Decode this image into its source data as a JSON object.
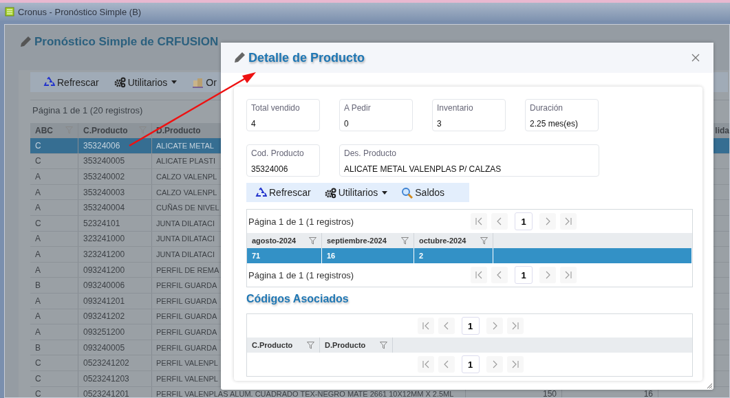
{
  "window": {
    "title": "Cronus - Pronóstico Simple (B)"
  },
  "page": {
    "title": "Pronóstico Simple de CRFUSION",
    "toolbar": [
      {
        "label": "Refrescar",
        "dropdown": false
      },
      {
        "label": "Utilitarios",
        "dropdown": true
      },
      {
        "label": "Or",
        "dropdown": false
      }
    ],
    "pager_text": "Página 1 de 1 (20 registros)",
    "table": {
      "columns": [
        {
          "label": "ABC",
          "filter": true
        },
        {
          "label": "C.Producto",
          "filter": true
        },
        {
          "label": "D.Producto"
        }
      ],
      "column_6": {
        "label": "lida"
      },
      "rows": [
        {
          "selected": true,
          "cells": [
            "C",
            "35324006",
            "ALICATE METAL"
          ]
        },
        {
          "selected": false,
          "cells": [
            "C",
            "353240005",
            "ALICATE PLASTI"
          ]
        },
        {
          "selected": false,
          "cells": [
            "A",
            "353240002",
            "CALZO VALENPL"
          ]
        },
        {
          "selected": false,
          "cells": [
            "A",
            "353240003",
            "CALZO VALENPL"
          ]
        },
        {
          "selected": false,
          "cells": [
            "A",
            "353240004",
            "CUÑAS DE NIVEL"
          ]
        },
        {
          "selected": false,
          "cells": [
            "C",
            "52324101",
            "JUNTA DILATACI"
          ]
        },
        {
          "selected": false,
          "cells": [
            "A",
            "323241000",
            "JUNTA DILATACI"
          ]
        },
        {
          "selected": false,
          "cells": [
            "A",
            "323241200",
            "JUNTA DILATACI"
          ]
        },
        {
          "selected": false,
          "cells": [
            "A",
            "093241200",
            "PERFIL DE REMA"
          ]
        },
        {
          "selected": false,
          "cells": [
            "B",
            "093240006",
            "PERFIL GUARDA"
          ]
        },
        {
          "selected": false,
          "cells": [
            "A",
            "093241201",
            "PERFIL GUARDA"
          ]
        },
        {
          "selected": false,
          "cells": [
            "A",
            "093241202",
            "PERFIL GUARDA"
          ]
        },
        {
          "selected": false,
          "cells": [
            "A",
            "093251200",
            "PERFIL GUARDA"
          ]
        },
        {
          "selected": false,
          "cells": [
            "B",
            "093240005",
            "PERFIL GUARDA"
          ]
        },
        {
          "selected": false,
          "cells": [
            "C",
            "0523241202",
            "PERFIL VALENPL"
          ]
        },
        {
          "selected": false,
          "cells": [
            "C",
            "0523241203",
            "PERFIL VALENPL"
          ]
        },
        {
          "selected": false,
          "cells": [
            "C",
            "0523241201",
            "PERFIL VALENPLAS ALUM. CUADRADO TEX-NEGRO MATE 2661 10X12MM X 2.5ML"
          ],
          "column_4": "150",
          "column_5": "16"
        }
      ]
    }
  },
  "modal": {
    "title": "Detalle de Producto",
    "fields": [
      {
        "label": "Total vendido",
        "value": "4",
        "wide": false
      },
      {
        "label": "A Pedir",
        "value": "0",
        "wide": false
      },
      {
        "label": "Inventario",
        "value": "3",
        "wide": false
      },
      {
        "label": "Duración",
        "value": "2.25 mes(es)",
        "wide": false
      },
      {
        "label": "Cod. Producto",
        "value": "35324006",
        "wide": false
      },
      {
        "label": "Des. Producto",
        "value": "ALICATE METAL VALENPLAS P/ CALZAS",
        "wide": true
      }
    ],
    "toolbar": [
      {
        "label": "Refrescar",
        "dropdown": false
      },
      {
        "label": "Utilitarios",
        "dropdown": true
      },
      {
        "label": "Saldos",
        "dropdown": false
      }
    ],
    "grids": [
      {
        "pager_top": {
          "text": "Página 1 de 1 (1 registros)",
          "page": "1"
        },
        "columns": [
          "agosto-2024",
          "septiembre-2024",
          "octubre-2024"
        ],
        "rows": [
          {
            "selected": true,
            "cells": [
              "71",
              "16",
              "2"
            ]
          }
        ],
        "pager_bottom": {
          "text": "Página 1 de 1 (1 registros)",
          "page": "1"
        }
      },
      {
        "heading": "Códigos Asociados",
        "pager_top": {
          "page": "1"
        },
        "columns": [
          "C.Producto",
          "D.Producto"
        ],
        "pager_bottom": {
          "page": "1"
        }
      }
    ]
  }
}
